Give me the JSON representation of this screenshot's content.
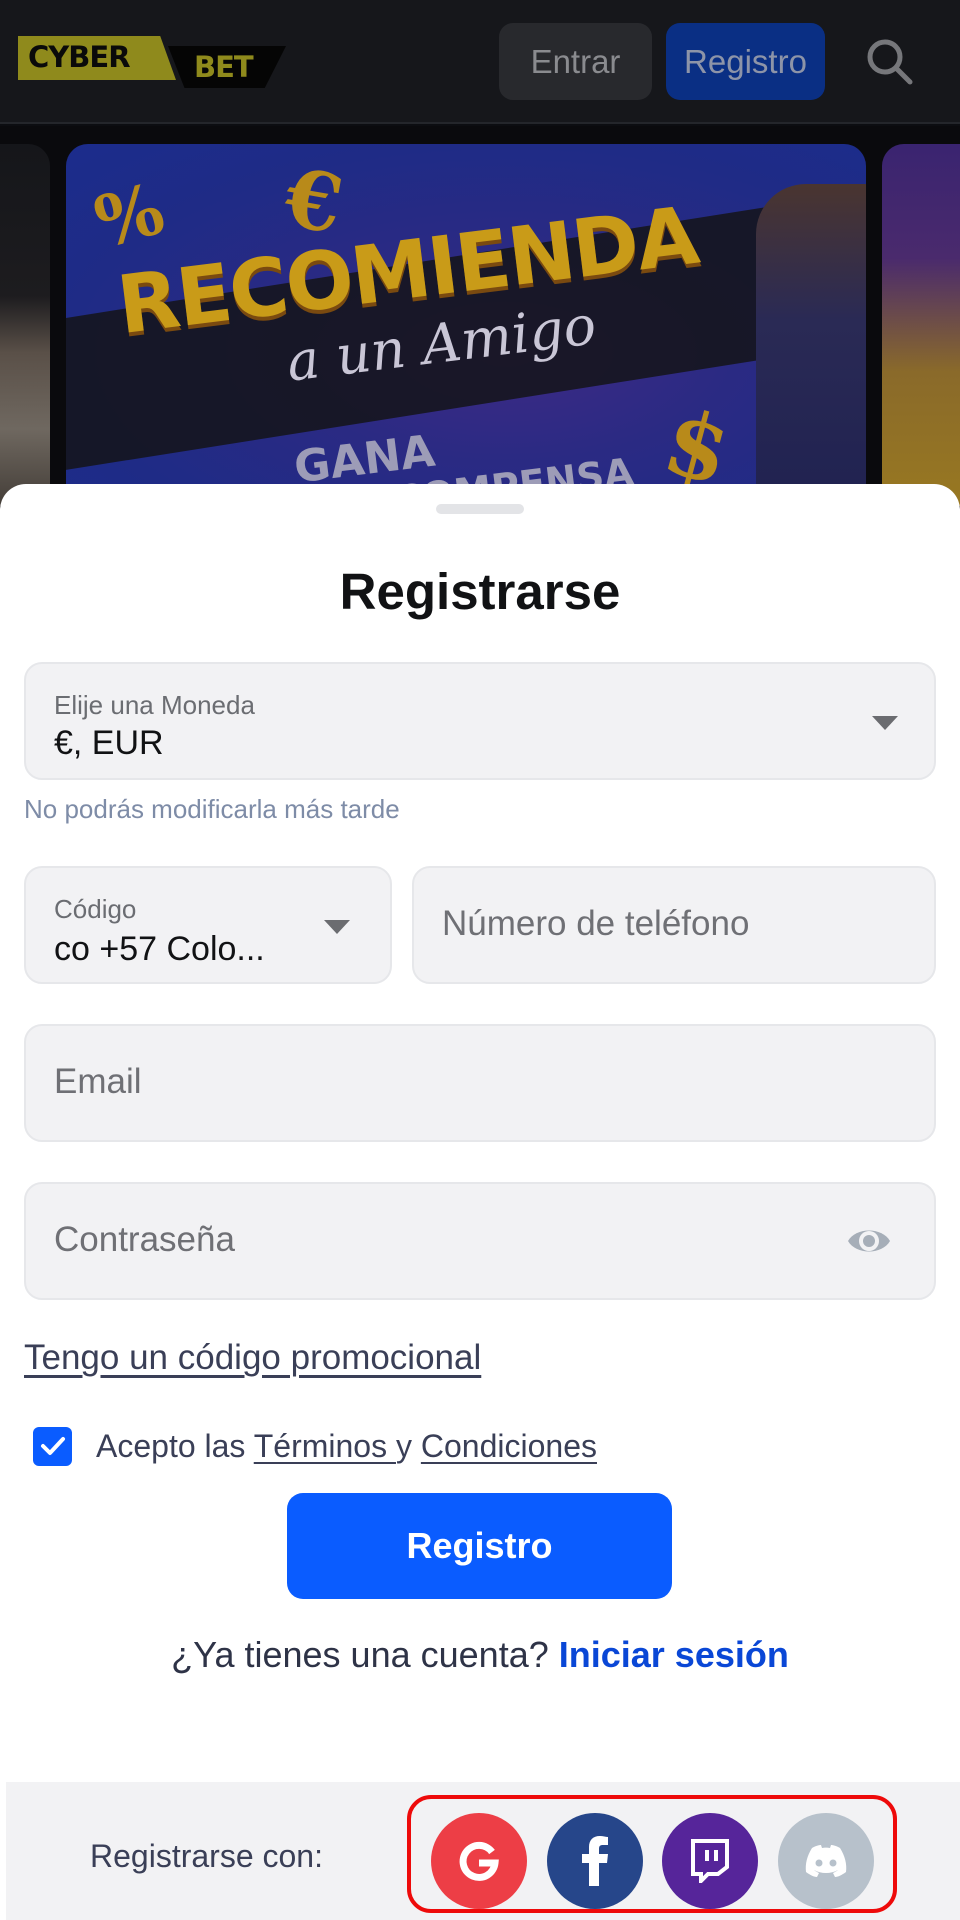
{
  "header": {
    "logo": {
      "part1": "CYBER",
      "part2": "BET"
    },
    "login_label": "Entrar",
    "register_label": "Registro",
    "search_icon": "search-icon"
  },
  "banner": {
    "title": "RECOMIENDA",
    "subtitle": "a un Amigo",
    "line1": "GANA",
    "line2": "RECOMPENSA",
    "deco_percent": "%",
    "deco_euro": "€",
    "deco_dollar": "$"
  },
  "sheet": {
    "title": "Registrarse",
    "currency": {
      "label": "Elije una Moneda",
      "value": "€, EUR",
      "hint": "No podrás modificarla más tarde"
    },
    "phone_code": {
      "label": "Código",
      "value": "co +57 Colo..."
    },
    "phone_number": {
      "placeholder": "Número de teléfono"
    },
    "email": {
      "placeholder": "Email"
    },
    "password": {
      "placeholder": "Contraseña",
      "toggle_icon": "eye-icon"
    },
    "promo_code_link": "Tengo un código promocional",
    "terms": {
      "checked": true,
      "prefix": "Acepto las ",
      "terms_link": "Términos ",
      "joiner": "y ",
      "conditions_link": "Condiciones"
    },
    "submit_label": "Registro",
    "login_prompt": "¿Ya tienes una cuenta? ",
    "login_link": "Iniciar sesión"
  },
  "social": {
    "label": "Registrarse con:",
    "providers": [
      {
        "name": "Google",
        "icon": "google-icon",
        "color": "#ed3e46"
      },
      {
        "name": "Facebook",
        "icon": "facebook-icon",
        "color": "#26468a"
      },
      {
        "name": "Twitch",
        "icon": "twitch-icon",
        "color": "#56259a"
      },
      {
        "name": "Discord",
        "icon": "discord-icon",
        "color": "#b7c1cb"
      }
    ],
    "highlight_color": "#ee0a0a"
  },
  "colors": {
    "primary": "#0a5cff",
    "link": "#0a47d6",
    "text": "#3a3f57",
    "hint": "#7e8ca7",
    "logo_yellow": "#8f8a1c"
  }
}
